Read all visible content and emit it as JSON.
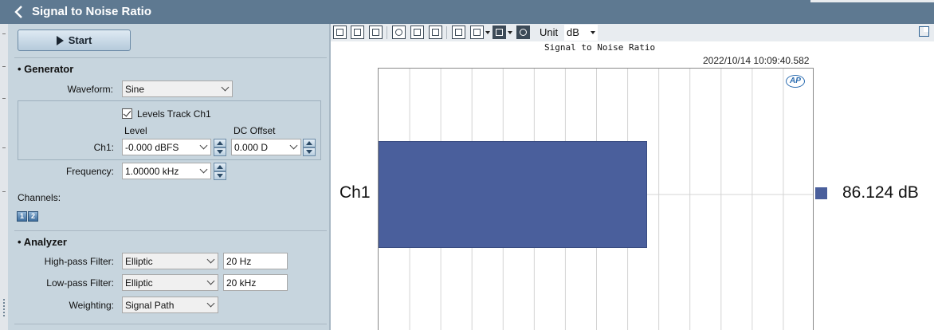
{
  "window": {
    "title": "Signal to Noise Ratio"
  },
  "controls": {
    "start_label": "Start"
  },
  "generator": {
    "heading": "Generator",
    "waveform_label": "Waveform:",
    "waveform_value": "Sine",
    "levels_track_label": "Levels Track Ch1",
    "level_header": "Level",
    "dc_offset_header": "DC Offset",
    "ch1_label": "Ch1:",
    "ch1_level": "-0.000 dBFS",
    "ch1_dc_offset": "0.000 D",
    "frequency_label": "Frequency:",
    "frequency_value": "1.00000 kHz",
    "channels_label": "Channels:",
    "channel_buttons": [
      "1",
      "2"
    ]
  },
  "analyzer": {
    "heading": "Analyzer",
    "highpass_label": "High-pass Filter:",
    "highpass_type": "Elliptic",
    "highpass_freq": "20 Hz",
    "lowpass_label": "Low-pass Filter:",
    "lowpass_type": "Elliptic",
    "lowpass_freq": "20 kHz",
    "weighting_label": "Weighting:",
    "weighting_value": "Signal Path"
  },
  "graph_toolbar": {
    "unit_label": "Unit",
    "unit_value": "dB"
  },
  "logo_text": "AP",
  "colors": {
    "bar": "#4a5f9c",
    "titlebar": "#5e7991",
    "panel": "#c7d5de"
  },
  "chart_data": {
    "type": "bar",
    "orientation": "horizontal",
    "title": "Signal to Noise Ratio",
    "timestamp": "2022/10/14 10:09:40.582",
    "categories": [
      "Ch1"
    ],
    "values": [
      86.124
    ],
    "value_labels": [
      "86.124 dB"
    ],
    "unit": "dB",
    "xlim": [
      0,
      140
    ],
    "grid": true
  }
}
